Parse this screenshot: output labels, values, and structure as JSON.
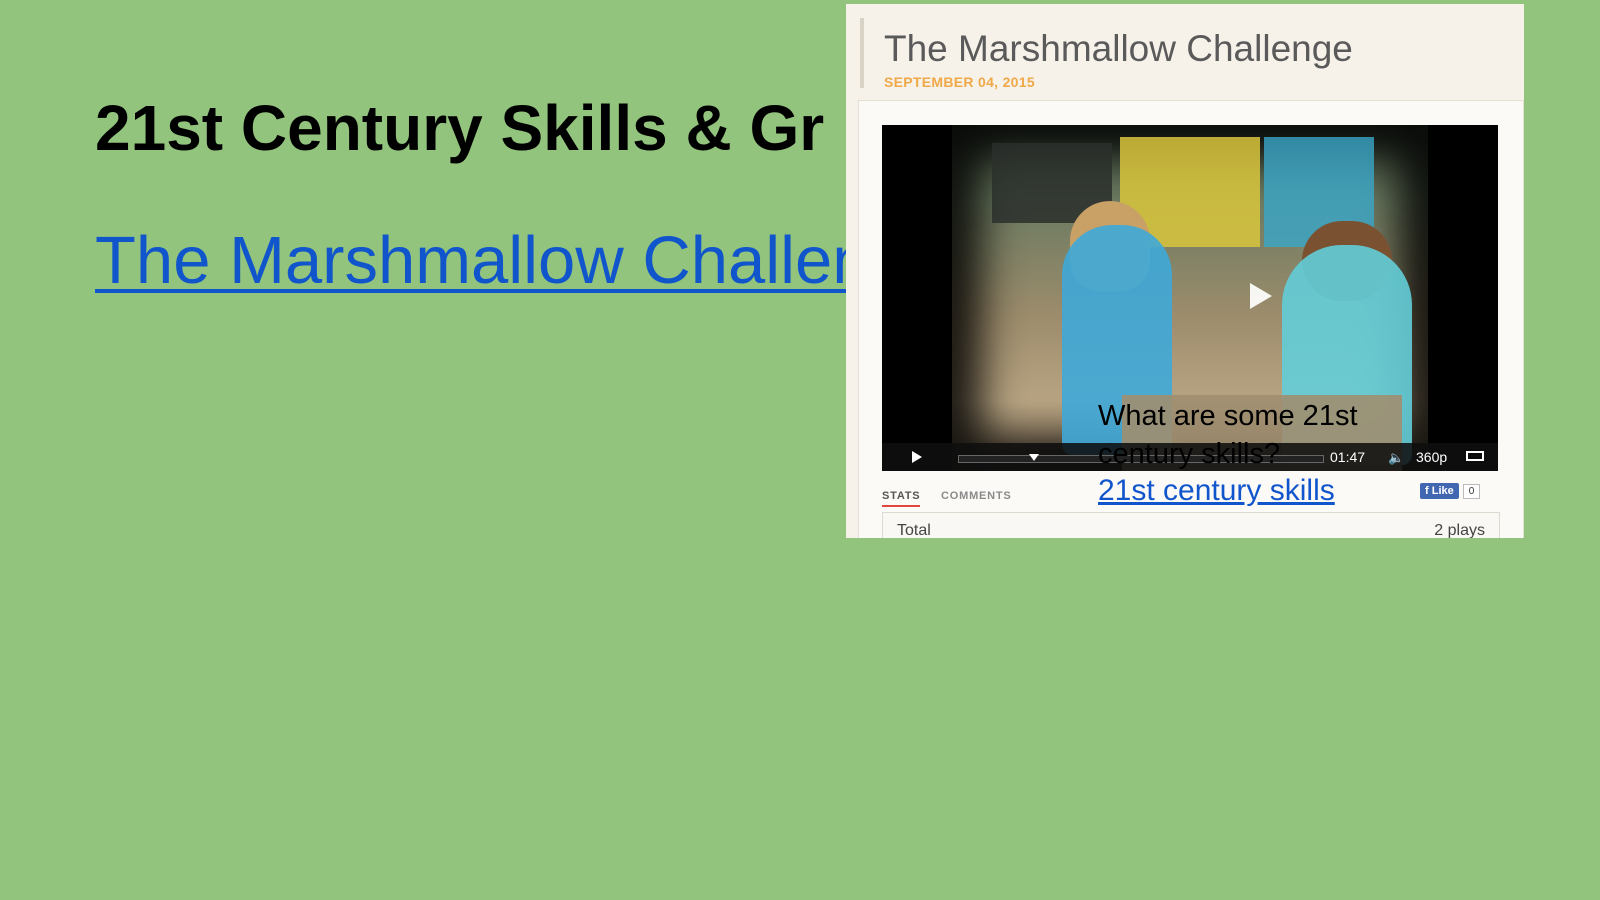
{
  "slide": {
    "title": "21st Century Skills & Gr",
    "link_text": "The Marshmallow Challen",
    "question": "What are some 21st century skills?",
    "question_link": "21st century skills"
  },
  "embed": {
    "title": "The Marshmallow Challenge",
    "date": "SEPTEMBER 04, 2015",
    "player": {
      "time": "01:47",
      "quality": "360p"
    },
    "tabs": [
      "STATS",
      "COMMENTS"
    ],
    "fb_like": "Like",
    "fb_count": "0",
    "stats": {
      "label": "Total",
      "value": "2 plays"
    }
  },
  "colors": {
    "background": "#93c47d",
    "link": "#1155cc",
    "date": "#f0a848"
  }
}
